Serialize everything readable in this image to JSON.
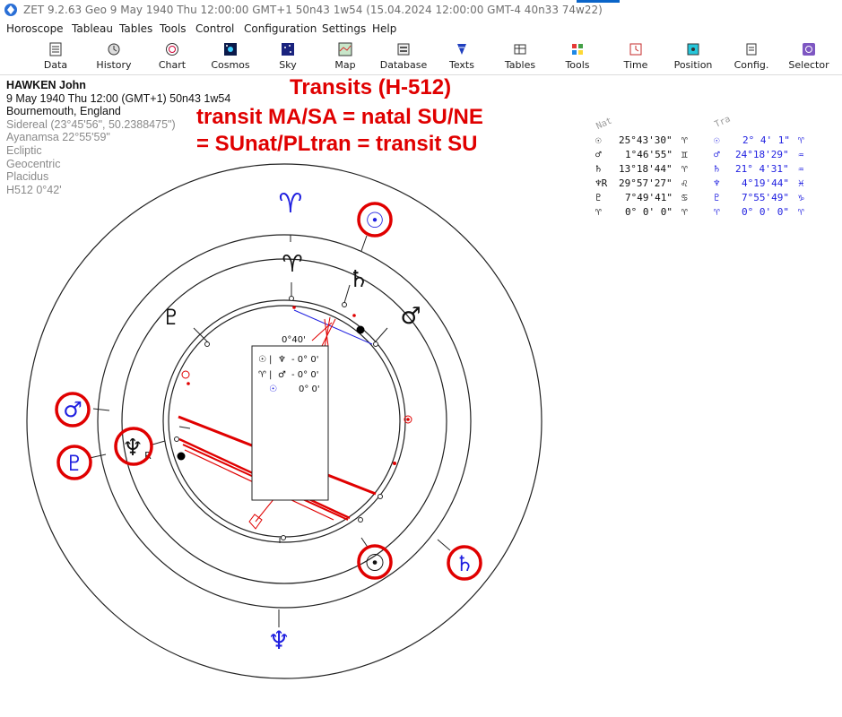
{
  "window": {
    "title": "ZET 9.2.63 Geo    9 May 1940  Thu  12:00:00 GMT+1 50n43  1w54  (15.04.2024  12:00:00 GMT-4 40n33 74w22)"
  },
  "menu": [
    "Horoscope",
    "Tableau",
    "Tables",
    "Tools",
    "Control",
    "Configuration",
    "Settings",
    "Help"
  ],
  "toolbar": [
    {
      "label": "Data",
      "icon": "data-icon"
    },
    {
      "label": "History",
      "icon": "history-icon"
    },
    {
      "label": "Chart",
      "icon": "chart-icon"
    },
    {
      "label": "Cosmos",
      "icon": "cosmos-icon"
    },
    {
      "label": "Sky",
      "icon": "sky-icon"
    },
    {
      "label": "Map",
      "icon": "map-icon"
    },
    {
      "label": "Database",
      "icon": "database-icon"
    },
    {
      "label": "Texts",
      "icon": "texts-icon"
    },
    {
      "label": "Tables",
      "icon": "tables-icon"
    },
    {
      "label": "Tools",
      "icon": "tools-icon"
    },
    {
      "label": "Time",
      "icon": "time-icon"
    },
    {
      "label": "Position",
      "icon": "position-icon"
    },
    {
      "label": "Config.",
      "icon": "config-icon"
    },
    {
      "label": "Selector",
      "icon": "selector-icon"
    }
  ],
  "info": {
    "name": "HAWKEN John",
    "datetime": "9 May 1940  Thu  12:00 (GMT+1) 50n43  1w54",
    "place": "Bournemouth, England",
    "sidereal": "Sidereal (23°45'56\", 50.2388475\")",
    "ayanamsa": "Ayanamsa 22°55'59\"",
    "ecliptic": "Ecliptic",
    "geocentric": "Geocentric",
    "placidus": "Placidus",
    "harmonic": "H512   0°42'"
  },
  "annotation": {
    "line1": "Transits (H-512)",
    "line2": "transit MA/SA = natal SU/NE",
    "line3": "= SUnat/PLtran = transit SU"
  },
  "table": {
    "header_natal": "Nat",
    "header_transit": "Tra",
    "rows": [
      {
        "n_glyph": "☉",
        "n_val": "25°43'30\"",
        "n_sign": "♈",
        "t_glyph": "☉",
        "t_val": "2° 4' 1\"",
        "t_sign": "♈"
      },
      {
        "n_glyph": "♂",
        "n_val": "1°46'55\"",
        "n_sign": "♊",
        "t_glyph": "♂",
        "t_val": "24°18'29\"",
        "t_sign": "♒"
      },
      {
        "n_glyph": "♄",
        "n_val": "13°18'44\"",
        "n_sign": "♈",
        "t_glyph": "♄",
        "t_val": "21° 4'31\"",
        "t_sign": "♒"
      },
      {
        "n_glyph": "♆R",
        "n_val": "29°57'27\"",
        "n_sign": "♌",
        "t_glyph": "♆",
        "t_val": "4°19'44\"",
        "t_sign": "♓"
      },
      {
        "n_glyph": "♇",
        "n_val": "7°49'41\"",
        "n_sign": "♋",
        "t_glyph": "♇",
        "t_val": "7°55'49\"",
        "t_sign": "♑"
      },
      {
        "n_glyph": "♈",
        "n_val": "0° 0' 0\"",
        "n_sign": "♈",
        "t_glyph": "♈",
        "t_val": "0° 0' 0\"",
        "t_sign": "♈"
      }
    ]
  },
  "chart": {
    "orb_label": "0°40'",
    "legend": [
      {
        "a": "☉",
        "b": "♆",
        "val": "- 0° 0'"
      },
      {
        "a": "♈",
        "b": "♂",
        "val": "- 0° 0'"
      },
      {
        "a": "☉",
        "b": "",
        "val": "0° 0'"
      }
    ],
    "glyphs": {
      "aries_outer": "♈",
      "aries_inner": "♈",
      "sun_outer": "☉",
      "saturn_inner": "♄",
      "mars_inner": "♂",
      "pluto_inner": "♇",
      "mars_outer": "♂",
      "pluto_outer": "♇",
      "neptune_inner": "♆",
      "neptune_retro": "R",
      "sun_inner": "☉",
      "saturn_outer": "♄",
      "neptune_outer": "♆"
    },
    "colors": {
      "red": "#e00000",
      "blue": "#1f1fe0",
      "black": "#111111"
    }
  }
}
